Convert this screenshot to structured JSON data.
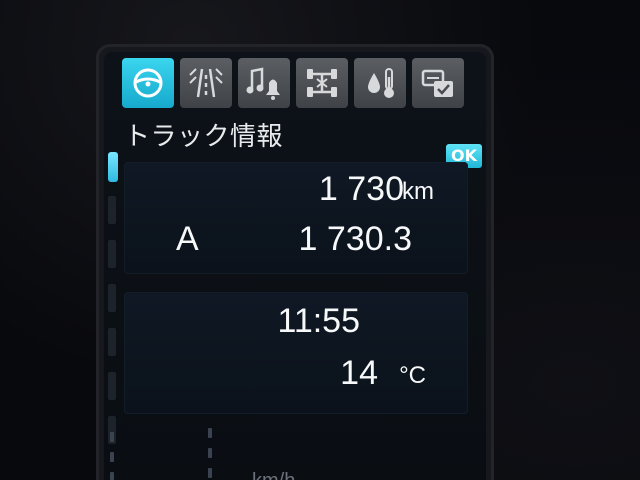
{
  "tabs": [
    {
      "icon": "steering-wheel-icon",
      "active": true
    },
    {
      "icon": "lane-assist-icon",
      "active": false
    },
    {
      "icon": "music-bell-icon",
      "active": false
    },
    {
      "icon": "axle-config-icon",
      "active": false
    },
    {
      "icon": "temperature-drop-icon",
      "active": false
    },
    {
      "icon": "settings-check-icon",
      "active": false
    }
  ],
  "section": {
    "title": "トラック情報",
    "ok_label": "OK"
  },
  "trip_panel": {
    "odometer_value": "1 730",
    "odometer_unit": "km",
    "trip_label": "A",
    "trip_value": "1 730.3"
  },
  "status_panel": {
    "time": "11:55",
    "temperature_value": "14",
    "temperature_unit": "°C"
  },
  "gauge": {
    "speed_unit": "km/h"
  },
  "colors": {
    "accent": "#1fb8da",
    "tab_inactive": "#4d5054",
    "panel_bg": "#0d1520",
    "text": "#f7f8f9"
  }
}
